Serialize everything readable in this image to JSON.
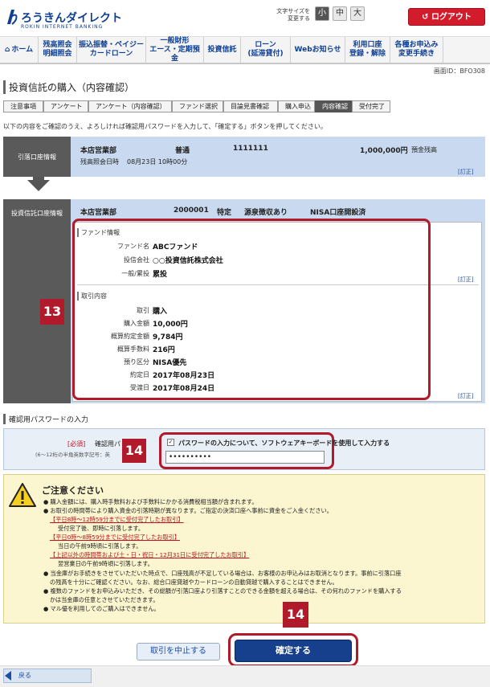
{
  "header": {
    "logo_text": "ろうきんダイレクト",
    "logo_sub": "ROKIN INTERNET BANKING",
    "fontsize_label_line1": "文字サイズを",
    "fontsize_label_line2": "変更する",
    "fontsize_small": "小",
    "fontsize_medium": "中",
    "fontsize_large": "大",
    "logout_label": "ログアウト"
  },
  "nav": {
    "home": "ホーム",
    "items": [
      {
        "line1": "残高照会",
        "line2": "明細照会"
      },
      {
        "line1": "振込振替・ペイジー",
        "line2": "カードローン"
      },
      {
        "line1": "一般財形",
        "line2": "エース・定期預金"
      },
      {
        "line1": "投資信託",
        "line2": ""
      },
      {
        "line1": "ローン",
        "line2": "(延滞貸付)"
      },
      {
        "line1": "Webお知らせ",
        "line2": ""
      },
      {
        "line1": "利用口座",
        "line2": "登録・解除"
      },
      {
        "line1": "各種お申込み",
        "line2": "変更手続き"
      }
    ]
  },
  "screen_id": "画面ID：BFO308",
  "page_title": "投資信託の購入（内容確認）",
  "steps": [
    "注意事項",
    "アンケート",
    "アンケート（内容確認）",
    "ファンド選択",
    "目論見書確認",
    "購入申込",
    "内容確認",
    "受付完了"
  ],
  "instruction": "以下の内容をご確認のうえ、よろしければ確認用パスワードを入力して、「確定する」ボタンを押してください。",
  "account": {
    "label": "引落口座情報",
    "branch": "本店営業部",
    "type": "普通",
    "number": "1111111",
    "amount": "1,000,000円",
    "amount_note": "預金残高",
    "balance_date_label": "残高照会日時",
    "balance_date": "08月23日 10時00分",
    "edit_link": "[訂正]"
  },
  "invest": {
    "label": "投資信託口座情報",
    "branch": "本店営業部",
    "account_no": "2000001",
    "account_type": "特定",
    "tax": "源泉徴収あり",
    "nisa": "NISA口座開設済",
    "fund_section": "ファンド情報",
    "fund_rows": [
      {
        "key": "ファンド名",
        "val": "ABCファンド"
      },
      {
        "key": "投信会社",
        "val": "○○投資信託株式会社"
      },
      {
        "key": "一般/累投",
        "val": "累投"
      }
    ],
    "fund_edit": "[訂正]",
    "trade_section": "取引内容",
    "trade_rows": [
      {
        "key": "取引",
        "val": "購入"
      },
      {
        "key": "購入金額",
        "val": "10,000円"
      },
      {
        "key": "概算約定金額",
        "val": "9,784円"
      },
      {
        "key": "概算手数料",
        "val": "216円"
      },
      {
        "key": "預り区分",
        "val": "NISA優先"
      },
      {
        "key": "約定日",
        "val": "2017年08月23日"
      },
      {
        "key": "受渡日",
        "val": "2017年08月24日"
      }
    ],
    "trade_edit": "[訂正]"
  },
  "badges": {
    "b13": "13",
    "b14a": "14",
    "b14b": "14"
  },
  "password": {
    "section_title": "確認用パスワードの入力",
    "required": "[必須]",
    "label": "確認用パ",
    "hint": "(6～12桁の半角英数字記号：英",
    "software_kb_label": "パスワードの入力について、ソフトウェアキーボードを使用して入力する",
    "value": "••••••••••"
  },
  "caution": {
    "title": "ご注意ください",
    "lines": [
      {
        "text": "● 購入金額には、購入時手数料および手数料にかかる消費税相当額が含まれます。",
        "style": "normal"
      },
      {
        "text": "● お取引の時間帯により購入資金の引落時期が異なります。ご指定の決済口座へ事前に資金をご入金ください。",
        "style": "normal"
      },
      {
        "text": "【平日8時～12時59分までに受付完了したお取引】",
        "style": "red"
      },
      {
        "text": "受付完了後、即時に引落します。",
        "style": "indent"
      },
      {
        "text": "【平日0時～8時59分までに受付完了したお取引】",
        "style": "red"
      },
      {
        "text": "当日の午前9時頃に引落します。",
        "style": "indent"
      },
      {
        "text": "【上記以外の時間帯および土・日・祝日・12月31日に受付完了したお取引】",
        "style": "red"
      },
      {
        "text": "翌営業日の午前9時頃に引落します。",
        "style": "indent"
      },
      {
        "text": "● 当金庫がお手続きをさせていただいた時点で、口座残高が不足している場合は、お客様のお申込みはお取消となります。事前に引落口座",
        "style": "normal"
      },
      {
        "text": "の残高を十分にご確認ください。なお、総合口座貸越やカードローンの自動貸越で購入することはできません。",
        "style": "indent"
      },
      {
        "text": "● 複数のファンドをお申込みいただき、その総額が引落口座より引落すことのできる金額を超える場合は、その何れのファンドを購入する",
        "style": "normal"
      },
      {
        "text": "かは当金庫の任意とさせていただきます。",
        "style": "indent"
      },
      {
        "text": "● マル優を利用してのご購入はできません。",
        "style": "normal"
      }
    ]
  },
  "buttons": {
    "cancel": "取引を中止する",
    "confirm": "確定する",
    "back": "戻る"
  }
}
